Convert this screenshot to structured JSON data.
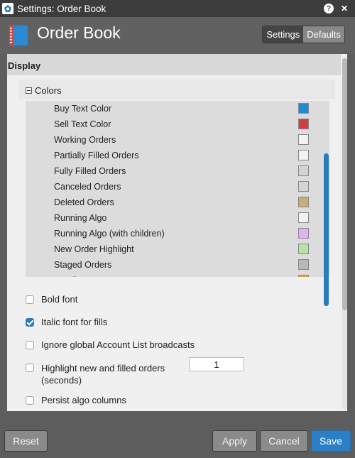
{
  "window": {
    "title": "Settings: Order Book"
  },
  "header": {
    "title": "Order Book",
    "tabs": [
      "Settings",
      "Defaults"
    ],
    "active_tab": "Settings"
  },
  "section": {
    "title": "Display"
  },
  "colors": {
    "label": "Colors",
    "items": [
      {
        "label": "Buy Text Color",
        "color": "#1f8ad6"
      },
      {
        "label": "Sell Text Color",
        "color": "#d83a3a"
      },
      {
        "label": "Working Orders",
        "color": "#f2f2f2"
      },
      {
        "label": "Partially Filled Orders",
        "color": "#f2f2f2"
      },
      {
        "label": "Fully Filled Orders",
        "color": "#d4d4d4"
      },
      {
        "label": "Canceled Orders",
        "color": "#d4d4d4"
      },
      {
        "label": "Deleted Orders",
        "color": "#c9ac7a"
      },
      {
        "label": "Running Algo",
        "color": "#f2f2f2"
      },
      {
        "label": "Running Algo (with children)",
        "color": "#e0b3f5"
      },
      {
        "label": "New Order Highlight",
        "color": "#b6e3a6"
      },
      {
        "label": "Staged Orders",
        "color": "#b8b8b8"
      },
      {
        "label": "Pending Buy",
        "color": "#f0a23a"
      }
    ]
  },
  "options": [
    {
      "label": "Bold font",
      "checked": false
    },
    {
      "label": "Italic font for fills",
      "checked": true
    },
    {
      "label": "Ignore global Account List broadcasts",
      "checked": false
    },
    {
      "label": "Highlight new and filled orders",
      "label2": "(seconds)",
      "checked": false,
      "value": "1"
    },
    {
      "label": "Persist algo columns",
      "checked": false
    }
  ],
  "footer": {
    "reset": "Reset",
    "apply": "Apply",
    "cancel": "Cancel",
    "save": "Save"
  }
}
